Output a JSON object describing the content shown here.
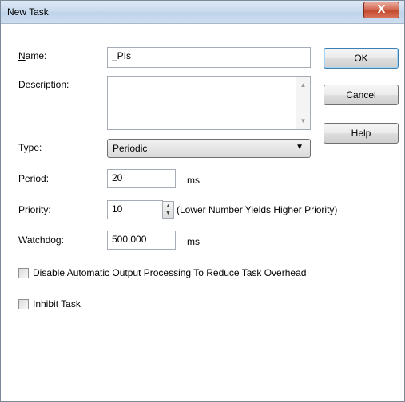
{
  "window": {
    "title": "New Task",
    "close_label": "X"
  },
  "form": {
    "name_label_u": "N",
    "name_label_rest": "ame:",
    "name_value": "_PIs",
    "description_label_u": "D",
    "description_label_rest": "escription:",
    "description_value": "",
    "type_label_pre": "T",
    "type_label_u": "y",
    "type_label_rest": "pe:",
    "type_value": "Periodic",
    "period_label": "Period:",
    "period_value": "20",
    "period_unit": "ms",
    "priority_label": "Priority:",
    "priority_value": "10",
    "priority_hint": "(Lower Number Yields Higher Priority)",
    "watchdog_label": "Watchdog:",
    "watchdog_value": "500.000",
    "watchdog_unit": "ms",
    "disable_output_label": "Disable Automatic Output Processing To Reduce Task Overhead",
    "disable_output_checked": false,
    "inhibit_label": "Inhibit Task",
    "inhibit_checked": false
  },
  "buttons": {
    "ok": "OK",
    "cancel": "Cancel",
    "help": "Help"
  }
}
